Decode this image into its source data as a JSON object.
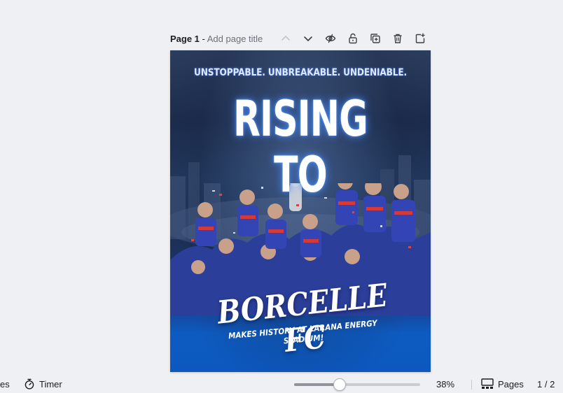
{
  "page_header": {
    "page_label": "Page 1",
    "separator": " - ",
    "title_placeholder": "Add page title"
  },
  "page_tools": [
    {
      "name": "chevron-up-icon",
      "state": "disabled"
    },
    {
      "name": "chevron-down-icon",
      "state": "enabled"
    },
    {
      "name": "hide-page-icon",
      "state": "enabled"
    },
    {
      "name": "lock-icon",
      "state": "enabled"
    },
    {
      "name": "duplicate-page-icon",
      "state": "enabled"
    },
    {
      "name": "trash-icon",
      "state": "enabled"
    },
    {
      "name": "add-page-icon",
      "state": "enabled"
    }
  ],
  "poster": {
    "tagline": "UNSTOPPABLE. UNBREAKABLE. UNDENIABLE.",
    "headline": "RISING TO",
    "team": "BORCELLE FC",
    "subline": "MAKES HISTORY AT LARANA ENERGY STADIUM!",
    "colors": {
      "accent_blue": "#0c58bf",
      "dark_navy": "#1d2c4c",
      "text": "#ffffff"
    }
  },
  "footer": {
    "notes_label": "es",
    "timer_label": "Timer",
    "zoom_slider_fraction": 0.36,
    "zoom_label": "38%",
    "pages_label": "Pages",
    "page_count": "1 / 2"
  }
}
